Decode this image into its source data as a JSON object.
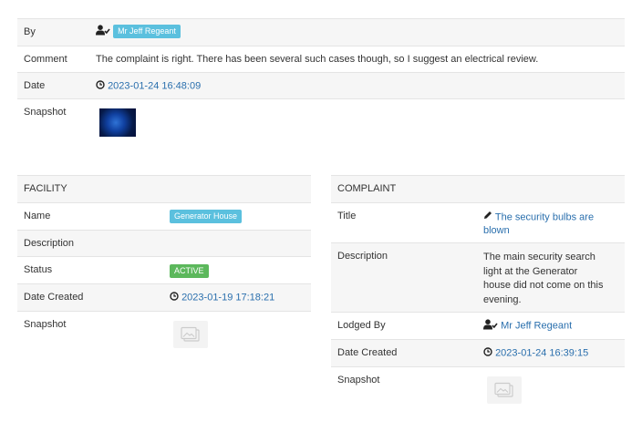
{
  "comment_table": {
    "by_label": "By",
    "by_value": "Mr Jeff Regeant",
    "comment_label": "Comment",
    "comment_value": "The complaint is right. There has been several such cases though, so I suggest an electrical review.",
    "date_label": "Date",
    "date_value": "2023-01-24 16:48:09",
    "snapshot_label": "Snapshot"
  },
  "facility": {
    "header": "FACILITY",
    "name_label": "Name",
    "name_value": "Generator House",
    "description_label": "Description",
    "description_value": "",
    "status_label": "Status",
    "status_value": "ACTIVE",
    "date_created_label": "Date Created",
    "date_created_value": "2023-01-19 17:18:21",
    "snapshot_label": "Snapshot"
  },
  "complaint": {
    "header": "COMPLAINT",
    "title_label": "Title",
    "title_value_line1": "The security bulbs are",
    "title_value_line2": "blown",
    "description_label": "Description",
    "description_line1": "The main security search",
    "description_line2": "light at the Generator",
    "description_line3": "house did not come on this",
    "description_line4": "evening.",
    "lodged_by_label": "Lodged By",
    "lodged_by_value": "Mr Jeff Regeant",
    "date_created_label": "Date Created",
    "date_created_value": "2023-01-24 16:39:15",
    "snapshot_label": "Snapshot"
  },
  "colors": {
    "link": "#2a6fad",
    "badge_info": "#5bc0de",
    "badge_success": "#5cb85c",
    "row_shade": "#f6f6f6"
  }
}
